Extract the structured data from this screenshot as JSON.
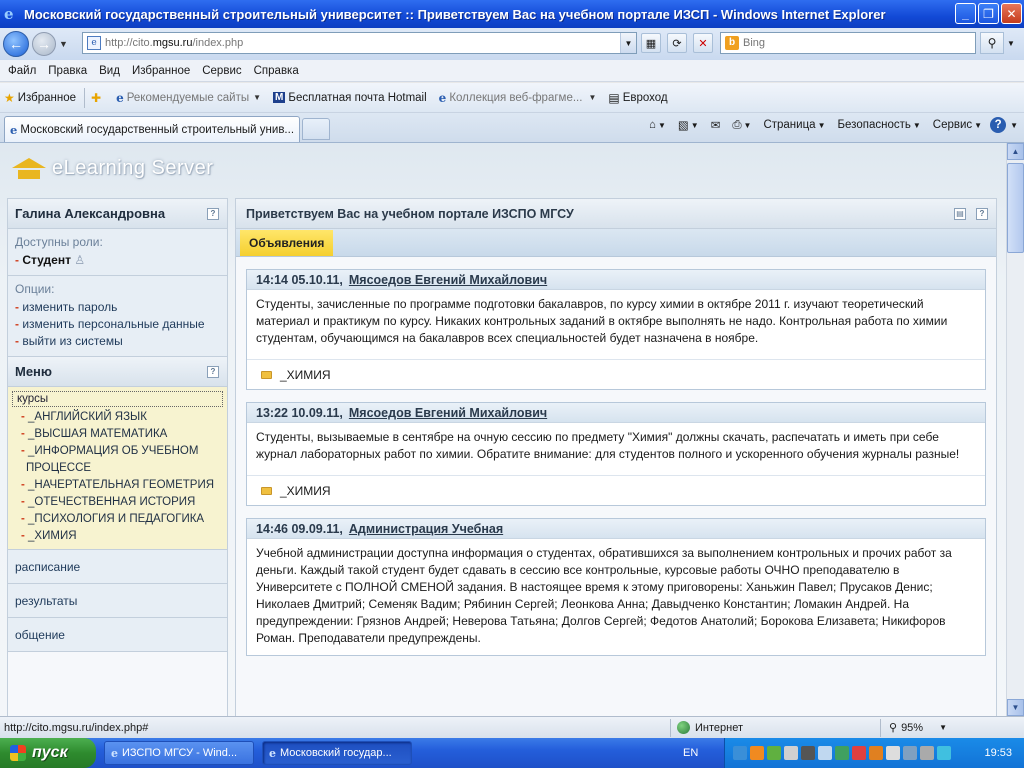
{
  "window": {
    "title": "Московский государственный строительный университет :: Приветствуем Вас на учебном портале ИЗСП - Windows Internet Explorer",
    "min": "_",
    "max": "❐",
    "close": "✕"
  },
  "address": {
    "url_prefix": "http://cito.",
    "url_domain": "mgsu.ru",
    "url_suffix": "/index.php",
    "search_placeholder": "Bing"
  },
  "menubar": [
    "Файл",
    "Правка",
    "Вид",
    "Избранное",
    "Сервис",
    "Справка"
  ],
  "favorites": {
    "label": "Избранное",
    "items": [
      {
        "label": "Рекомендуемые сайты",
        "dim": true
      },
      {
        "label": "Бесплатная почта Hotmail",
        "dim": false
      },
      {
        "label": "Коллекция веб-фрагме...",
        "dim": true
      },
      {
        "label": "Евроход",
        "dim": false
      }
    ]
  },
  "tab": {
    "label": "Московский государственный строительный унив..."
  },
  "commands": {
    "page": "Страница",
    "security": "Безопасность",
    "tools": "Сервис"
  },
  "logo": {
    "text": "eLearning Server"
  },
  "sidebar": {
    "user_name": "Галина  Александровна",
    "roles_label": "Доступны роли:",
    "role": "Студент",
    "options_label": "Опции:",
    "options": [
      "изменить пароль",
      "изменить персональные данные",
      "выйти из системы"
    ],
    "menu_title": "Меню",
    "courses_label": "курсы",
    "courses": [
      "_АНГЛИЙСКИЙ ЯЗЫК",
      "_ВЫСШАЯ МАТЕМАТИКА",
      "_ИНФОРМАЦИЯ ОБ УЧЕБНОМ ПРОЦЕССЕ",
      "_НАЧЕРТАТЕЛЬНАЯ ГЕОМЕТРИЯ",
      "_ОТЕЧЕСТВЕННАЯ ИСТОРИЯ",
      "_ПСИХОЛОГИЯ И ПЕДАГОГИКА",
      "_ХИМИЯ"
    ],
    "links": [
      "расписание",
      "результаты",
      "общение"
    ]
  },
  "main": {
    "title": "Приветствуем Вас на учебном портале ИЗСПО МГСУ",
    "tab_announcements": "Объявления",
    "posts": [
      {
        "time": "14:14 05.10.11,",
        "author": "Мясоедов Евгений Михайлович",
        "body": "Студенты, зачисленные по программе подготовки бакалавров, по курсу химии в октябре 2011 г. изучают теоретический материал и практикум по курсу. Никаких контрольных заданий в октябре выполнять не надо. Контрольная работа по химии студентам, обучающимся на бакалавров всех специальностей будет назначена в ноябре.",
        "course": "_ХИМИЯ"
      },
      {
        "time": "13:22 10.09.11,",
        "author": "Мясоедов Евгений Михайлович",
        "body": "Студенты, вызываемые в сентябре на очную сессию по предмету \"Химия\" должны скачать, распечатать и иметь при себе журнал лабораторных работ по химии. Обратите внимание: для студентов полного и ускоренного обучения журналы разные!",
        "course": "_ХИМИЯ"
      },
      {
        "time": "14:46 09.09.11,",
        "author": "Администрация Учебная",
        "body": "Учебной администрации доступна информация о студентах, обратившихся за выполнением контрольных и прочих работ за деньги. Каждый такой студент будет сдавать в сессию все контрольные, курсовые работы ОЧНО преподавателю в Университете с ПОЛНОЙ СМЕНОЙ задания. В настоящее время к этому приговорены: Ханьжин Павел; Прусаков Денис; Николаев Дмитрий; Семеняк Вадим; Рябинин Сергей; Леонкова Анна; Давыдченко Константин; Ломакин Андрей. На предупреждении: Грязнов Андрей; Неверова Татьяна; Долгов Сергей; Федотов Анатолий; Борокова Елизавета; Никифоров Роман. Преподаватели предупреждены.",
        "course": ""
      }
    ]
  },
  "statusbar": {
    "url": "http://cito.mgsu.ru/index.php#",
    "zone": "Интернет",
    "zoom": "95%"
  },
  "taskbar": {
    "start": "пуск",
    "tasks": [
      "ИЗСПО МГСУ - Wind...",
      "Московский государ..."
    ],
    "lang": "EN",
    "clock": "19:53"
  }
}
